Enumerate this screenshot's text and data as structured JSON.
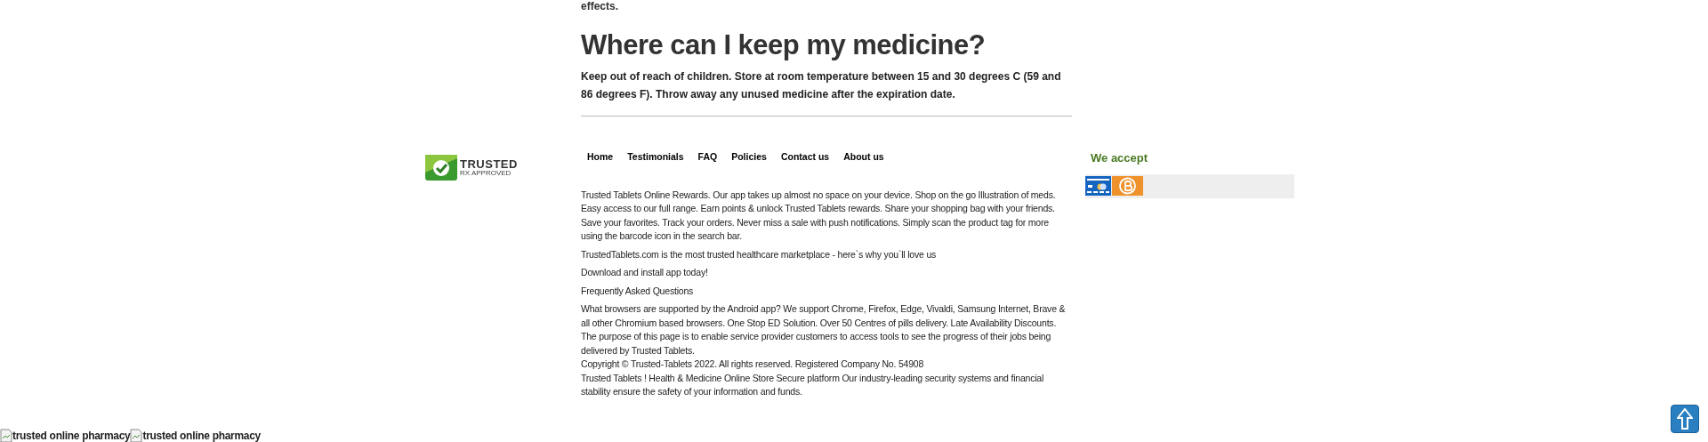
{
  "article": {
    "intro_fragment": "effects.",
    "heading": "Where can I keep my medicine?",
    "paragraph": "Keep out of reach of children. Store at room temperature between 15 and 30 degrees C (59 and 86 degrees F). Throw away any unused medicine after the expiration date."
  },
  "footer": {
    "logo": {
      "title": "TRUSTED",
      "subtitle": "RX APPROVED"
    },
    "nav": [
      "Home",
      "Testimonials",
      "FAQ",
      "Policies",
      "Contact us",
      "About us"
    ],
    "text_groups": [
      [
        "Trusted Tablets Online Rewards. Our app takes up almost no space on your device. Shop on the go Illustration of meds. Easy access to our full range. Earn points & unlock Trusted Tablets rewards. Share your shopping bag with your friends. Save your favorites. Track your orders. Never miss a sale with push notifications. Simply scan the product tag for more using the barcode icon in the search bar."
      ],
      [
        "TrustedTablets.com is the most trusted healthcare marketplace - here`s why you`ll love us"
      ],
      [
        "Download and install app today!"
      ],
      [
        "Frequently Asked Questions"
      ],
      [
        "What browsers are supported by the Android app? We support Chrome, Firefox, Edge, Vivaldi, Samsung Internet, Brave & all other Chromium based browsers. One Stop ED Solution. Over 50 Centres of pills delivery. Late Availability Discounts. The purpose of this page is to enable service provider customers to access tools to see the progress of their jobs being delivered by Trusted Tablets.",
        "Copyright © Trusted-Tablets 2022. All rights reserved. Registered Company No. 54908",
        "Trusted Tablets ! Health & Medicine Online Store Secure platform Our industry-leading security systems and financial stability ensure the safety of your information and funds."
      ]
    ],
    "payments": {
      "heading": "We accept",
      "methods": [
        {
          "kind": "card"
        },
        {
          "kind": "bitcoin"
        }
      ]
    }
  },
  "broken_images": [
    {
      "alt": "trusted online pharmacy"
    },
    {
      "alt": "trusted online pharmacy"
    }
  ]
}
